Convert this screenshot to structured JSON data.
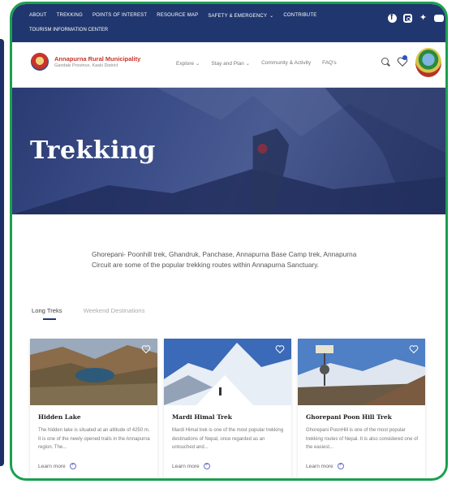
{
  "topbar": {
    "links": [
      "About",
      "Trekking",
      "Points of Interest",
      "Resource Map",
      "Safety & Emergency",
      "Contribute"
    ],
    "link2": "Tourism Information Center",
    "social": [
      "facebook-icon",
      "instagram-icon",
      "twitter-icon",
      "youtube-icon"
    ]
  },
  "header": {
    "brand_name": "Annapurna Rural Municipality",
    "brand_sub": "Gandaki Province, Kaski District",
    "nav": [
      "Explore",
      "Stay and Plan",
      "Community & Activity",
      "FAQ's"
    ]
  },
  "hero": {
    "title": "Trekking"
  },
  "intro": {
    "text": "Ghorepani- Poonhill trek, Ghandruk, Panchase, Annapurna Base Camp trek, Annapurna Circuit are some of the popular trekking routes within Annapurna Sanctuary."
  },
  "tabs": [
    {
      "label": "Long Treks",
      "active": true
    },
    {
      "label": "Weekend Destinations",
      "active": false
    }
  ],
  "cards": [
    {
      "title": "Hidden Lake",
      "desc": "The hidden lake is situated at an altitude of 4250 m. It is one of the newly opened trails in the Annapurna region. The...",
      "more": "Learn more"
    },
    {
      "title": "Mardi Himal Trek",
      "desc": "Mardi Himal trek is one of the most popular trekking destinations of Nepal, once regarded as an untouched and...",
      "more": "Learn more"
    },
    {
      "title": "Ghorepani Poon Hill Trek",
      "desc": "Ghorepani PoonHill is one of the most popular trekking routes of Nepal. It is also considered one of the easiest...",
      "more": "Learn more"
    }
  ],
  "colors": {
    "primary": "#20366f",
    "frame": "#1aa04f",
    "brand_red": "#c7352b"
  }
}
